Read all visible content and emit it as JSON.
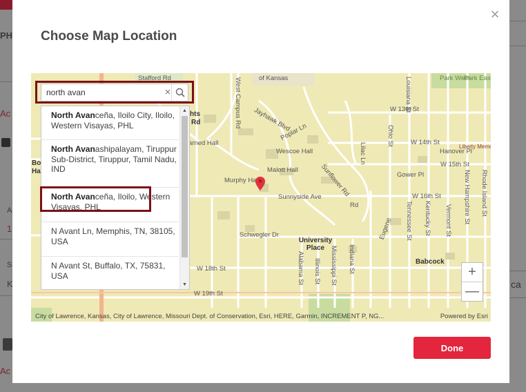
{
  "background": {
    "left_texts": [
      "PHC",
      "Ac",
      "A",
      "1",
      "S",
      "K",
      "Ac"
    ],
    "right_text": "ca"
  },
  "modal": {
    "title": "Choose Map Location",
    "close_icon": "×",
    "done_label": "Done"
  },
  "search": {
    "value": "north avan",
    "clear_icon": "×"
  },
  "suggestions": [
    {
      "match": "North Avan",
      "rest": "ceña, Iloilo City, Iloilo, Western Visayas, PHL"
    },
    {
      "match": "North Avan",
      "rest": "ashipalayam, Tiruppur Sub-District, Tiruppur, Tamil Nadu, IND"
    },
    {
      "match": "North Avan",
      "rest": "ceña, Iloilo, Western Visayas, PHL"
    },
    {
      "match": "",
      "rest": "N Avant Ln, Memphis, TN, 38105, USA"
    },
    {
      "match": "",
      "rest": "N Avant St, Buffalo, TX, 75831, USA"
    }
  ],
  "map": {
    "labels": {
      "stafford": "Stafford Rd",
      "kansas": "of Kansas",
      "west_campus": "West Campus Rd",
      "park_west": "Park West",
      "park_east": "Park East",
      "w13": "W 13th St",
      "w14": "W 14th St",
      "hanover": "Hanover Pl",
      "w15": "W 15th St",
      "jayhawk": "Jayhawk Blvd",
      "poplar": "Poplar Ln",
      "wescoe": "Wescoe Hall",
      "malott": "Malott Hall",
      "murphy": "Murphy Hall",
      "liberty": "Liberty Memorial Central Middle School",
      "gower": "Gower Pl",
      "sunnyside": "Sunnyside Ave",
      "w16": "W 16th St",
      "sunflower": "Sunflower Rd",
      "schwegler": "Schwegler Dr",
      "university": "University Place",
      "w18": "W 18th St",
      "babcock": "Babcock",
      "w19": "W 19th St",
      "lilac": "Lilac Ln",
      "ohio": "Ohio St",
      "louisiana": "Louisiana St",
      "kentucky": "Kentucky St",
      "tennessee": "Tennessee St",
      "vermont": "Vermont St",
      "nh": "New Hampshire St",
      "rhode": "Rhode Island St",
      "alabama": "Alabama St",
      "illinois": "Illinois St",
      "mississippi": "Mississippi St",
      "indiana": "Indiana St",
      "eugene": "Eugene",
      "rd": "Rd",
      "hts": "hts",
      "rd2": "Rd",
      "arned": "arned Hall",
      "bo": "Bo",
      "ha": "Ha"
    },
    "attribution": "City of Lawrence, Kansas, City of Lawrence, Missouri Dept. of Conservation, Esri, HERE, Garmin, INCREMENT P, NG...",
    "powered_by": "Powered by Esri",
    "zoom_in": "+",
    "zoom_out": "—",
    "colors": {
      "land": "#efe9b5",
      "park": "#c8dca0",
      "road": "#ffffff",
      "highway": "#f3b48c",
      "pin": "#e0313c"
    }
  }
}
